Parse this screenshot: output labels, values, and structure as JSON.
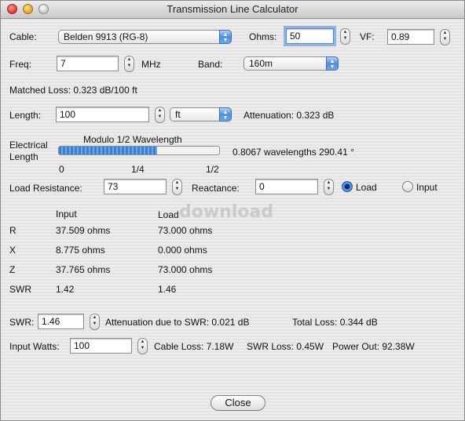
{
  "window": {
    "title": "Transmission Line Calculator"
  },
  "cable": {
    "label": "Cable:",
    "value": "Belden 9913 (RG-8)"
  },
  "ohms": {
    "label": "Ohms:",
    "value": "50"
  },
  "vf": {
    "label": "VF:",
    "value": "0.89"
  },
  "freq": {
    "label": "Freq:",
    "value": "7",
    "unit": "MHz"
  },
  "band": {
    "label": "Band:",
    "value": "160m"
  },
  "matched_loss": "Matched Loss: 0.323 dB/100 ft",
  "length": {
    "label": "Length:",
    "value": "100",
    "unit": "ft",
    "attenuation": "Attenuation: 0.323 dB"
  },
  "electrical": {
    "label_line1": "Electrical",
    "label_line2": "Length",
    "bar_title": "Modulo 1/2 Wavelength",
    "fraction": 0.6134,
    "tick0": "0",
    "tick1": "1/4",
    "tick2": "1/2",
    "readout": "0.8067 wavelengths  290.41 °"
  },
  "load": {
    "resistance_label": "Load Resistance:",
    "resistance_value": "73",
    "reactance_label": "Reactance:",
    "reactance_value": "0",
    "radio_load": "Load",
    "radio_input": "Input",
    "selected": "Load"
  },
  "table": {
    "col_input": "Input",
    "col_load": "Load",
    "rows": [
      {
        "name": "R",
        "input": "37.509 ohms",
        "load": "73.000 ohms"
      },
      {
        "name": "X",
        "input": "8.775 ohms",
        "load": "0.000 ohms"
      },
      {
        "name": "Z",
        "input": "37.765 ohms",
        "load": "73.000 ohms"
      },
      {
        "name": "SWR",
        "input": "1.42",
        "load": "1.46"
      }
    ]
  },
  "swr": {
    "label": "SWR:",
    "value": "1.46",
    "attenuation": "Attenuation due to SWR:  0.021 dB",
    "total_loss": "Total Loss: 0.344 dB"
  },
  "watts": {
    "label": "Input Watts:",
    "value": "100",
    "cable_loss": "Cable Loss: 7.18W",
    "swr_loss": "SWR Loss: 0.45W",
    "power_out": "Power Out: 92.38W"
  },
  "close_label": "Close",
  "watermark": "download"
}
